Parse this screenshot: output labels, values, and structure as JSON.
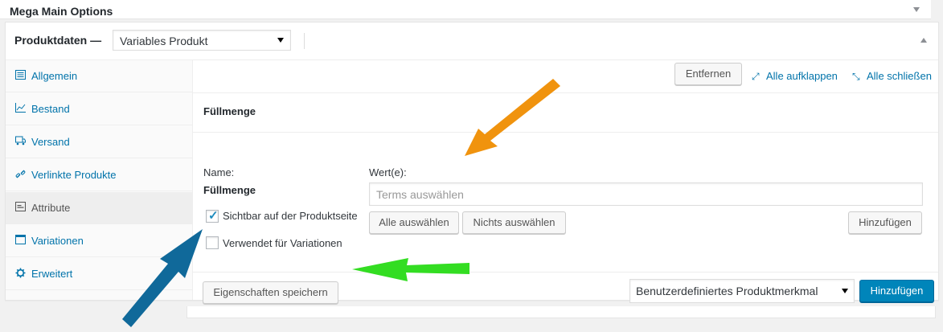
{
  "mega_box": {
    "title": "Mega Main Options"
  },
  "product_data": {
    "label": "Produktdaten —",
    "type_select": "Variables Produkt"
  },
  "tabs": [
    {
      "label": "Allgemein",
      "icon": "general-icon"
    },
    {
      "label": "Bestand",
      "icon": "chart-icon"
    },
    {
      "label": "Versand",
      "icon": "truck-icon"
    },
    {
      "label": "Verlinkte Produkte",
      "icon": "link-icon"
    },
    {
      "label": "Attribute",
      "icon": "list-icon"
    },
    {
      "label": "Variationen",
      "icon": "window-icon"
    },
    {
      "label": "Erweitert",
      "icon": "gear-icon"
    }
  ],
  "toolbar": {
    "expand_all": "Alle aufklappen",
    "close_all": "Alle schließen"
  },
  "attribute": {
    "title": "Füllmenge",
    "remove_button": "Entfernen",
    "name_label": "Name:",
    "name_value": "Füllmenge",
    "values_label": "Wert(e):",
    "terms_placeholder": "Terms auswählen",
    "visible_label": "Sichtbar auf der Produktseite",
    "visible_checked": true,
    "variations_label": "Verwendet für Variationen",
    "variations_checked": false,
    "select_all": "Alle auswählen",
    "select_none": "Nichts auswählen",
    "add_term": "Hinzufügen"
  },
  "footer": {
    "save_button": "Eigenschaften speichern",
    "attribute_select": "Benutzerdefiniertes Produktmerkmal",
    "add_button": "Hinzufügen"
  },
  "colors": {
    "link": "#0073aa",
    "primary_button": "#0085ba",
    "annotation_orange": "#f0930e",
    "annotation_green": "#33dd22",
    "annotation_blue": "#10699a"
  }
}
